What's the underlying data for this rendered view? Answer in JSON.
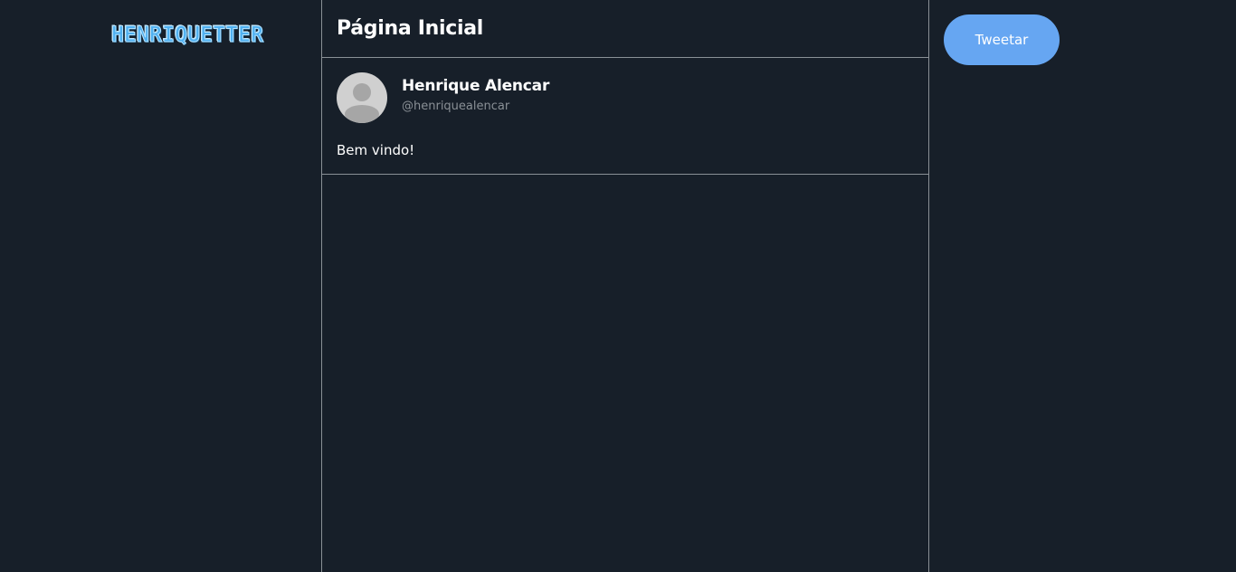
{
  "brand": {
    "logo_text": "HENRIQUETTER",
    "logo_color": "#4fb0f0"
  },
  "header": {
    "title": "Página Inicial"
  },
  "feed": {
    "tweets": [
      {
        "display_name": "Henrique Alencar",
        "handle": "@henriquealencar",
        "text": "Bem vindo!",
        "avatar_icon": "default-user-icon"
      }
    ]
  },
  "actions": {
    "tweet_button_label": "Tweetar",
    "tweet_button_color": "#66a6f2"
  },
  "theme": {
    "background": "#171f29",
    "divider": "#8a9096",
    "text_primary": "#ffffff",
    "text_secondary": "#8a9096"
  }
}
